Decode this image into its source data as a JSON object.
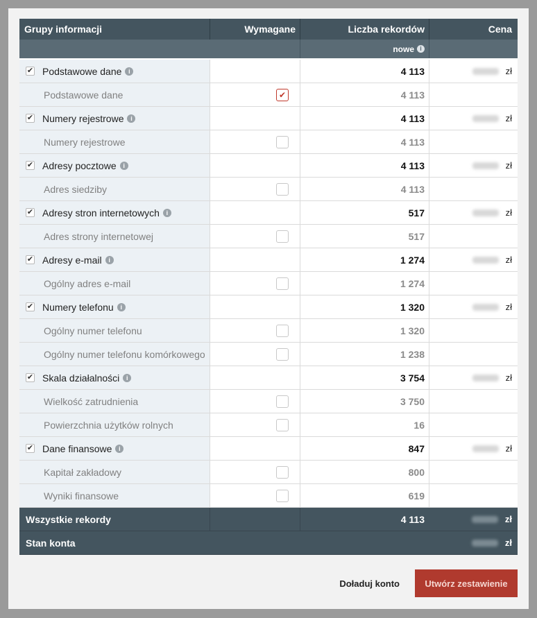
{
  "header": {
    "col_groups": "Grupy informacji",
    "col_required": "Wymagane",
    "col_records": "Liczba rekordów",
    "col_price": "Cena",
    "new_label": "nowe",
    "info_glyph": "i"
  },
  "currency": "zł",
  "check_glyph": "✔",
  "rows": [
    {
      "label": "Podstawowe dane",
      "records": "4 113"
    },
    {
      "label": "Podstawowe dane",
      "records": "4 113"
    },
    {
      "label": "Numery rejestrowe",
      "records": "4 113"
    },
    {
      "label": "Numery rejestrowe",
      "records": "4 113"
    },
    {
      "label": "Adresy pocztowe",
      "records": "4 113"
    },
    {
      "label": "Adres siedziby",
      "records": "4 113"
    },
    {
      "label": "Adresy stron internetowych",
      "records": "517"
    },
    {
      "label": "Adres strony internetowej",
      "records": "517"
    },
    {
      "label": "Adresy e-mail",
      "records": "1 274"
    },
    {
      "label": "Ogólny adres e-mail",
      "records": "1 274"
    },
    {
      "label": "Numery telefonu",
      "records": "1 320"
    },
    {
      "label": "Ogólny numer telefonu",
      "records": "1 320"
    },
    {
      "label": "Ogólny numer telefonu komórkowego",
      "records": "1 238"
    },
    {
      "label": "Skala działalności",
      "records": "3 754"
    },
    {
      "label": "Wielkość zatrudnienia",
      "records": "3 750"
    },
    {
      "label": "Powierzchnia użytków rolnych",
      "records": "16"
    },
    {
      "label": "Dane finansowe",
      "records": "847"
    },
    {
      "label": "Kapitał zakładowy",
      "records": "800"
    },
    {
      "label": "Wyniki finansowe",
      "records": "619"
    }
  ],
  "footer": {
    "all_records_label": "Wszystkie rekordy",
    "all_records_value": "4 113",
    "balance_label": "Stan konta"
  },
  "actions": {
    "topup_label": "Doładuj konto",
    "create_label": "Utwórz zestawienie"
  },
  "colors": {
    "header_bg": "#44555f",
    "subheader_bg": "#5a6b75",
    "primary": "#b03a2e",
    "required_checked": "#c0392b"
  }
}
